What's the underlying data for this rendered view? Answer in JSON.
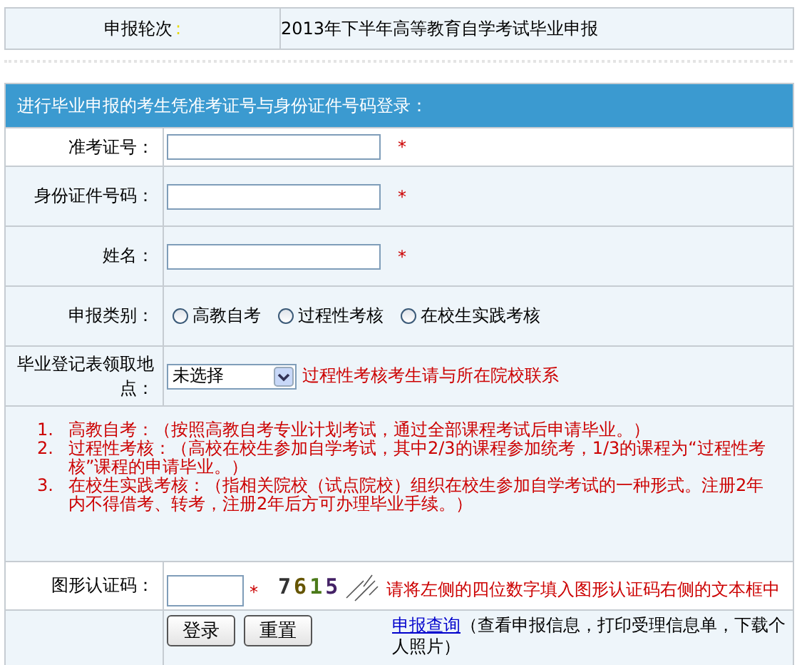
{
  "round": {
    "label": "申报轮次",
    "colon": ":",
    "value": "2013年下半年高等教育自学考试毕业申报"
  },
  "login_header": "进行毕业申报的考生凭准考证号与身份证件号码登录：",
  "fields": [
    {
      "label": "准考证号：",
      "required_mark": "*"
    },
    {
      "label": "身份证件号码：",
      "required_mark": "*"
    },
    {
      "label": "姓名：",
      "required_mark": "*"
    }
  ],
  "category": {
    "label": "申报类别：",
    "options": [
      {
        "label": "高教自考",
        "selected": false
      },
      {
        "label": "过程性考核",
        "selected": false
      },
      {
        "label": "在校生实践考核",
        "selected": false
      }
    ]
  },
  "pickup": {
    "label": "毕业登记表领取地点：",
    "value": "未选择",
    "hint": "过程性考核考生请与所在院校联系"
  },
  "notes": [
    {
      "number": "1.",
      "text": "高教自考：（按照高教自考专业计划考试，通过全部课程考试后申请毕业。）"
    },
    {
      "number": "2.",
      "text": "过程性考核：（高校在校生参加自学考试，其中2/3的课程参加统考，1/3的课程为“过程性考核”课程的申请毕业。）"
    },
    {
      "number": "3.",
      "text": "在校生实践考核：（指相关院校（试点院校）组织在校生参加自学考试的一种形式。注册2年内不得借考、转考，注册2年后方可办理毕业手续。）"
    }
  ],
  "captcha": {
    "label": "图形认证码：",
    "required_mark": "*",
    "code": "7615",
    "hint": "请将左侧的四位数字填入图形认证码右侧的文本框中"
  },
  "buttons": [
    "登录",
    "重置"
  ],
  "query": {
    "link": "申报查询",
    "text": "（查看申报信息，打印受理信息单，下载个人照片）"
  }
}
